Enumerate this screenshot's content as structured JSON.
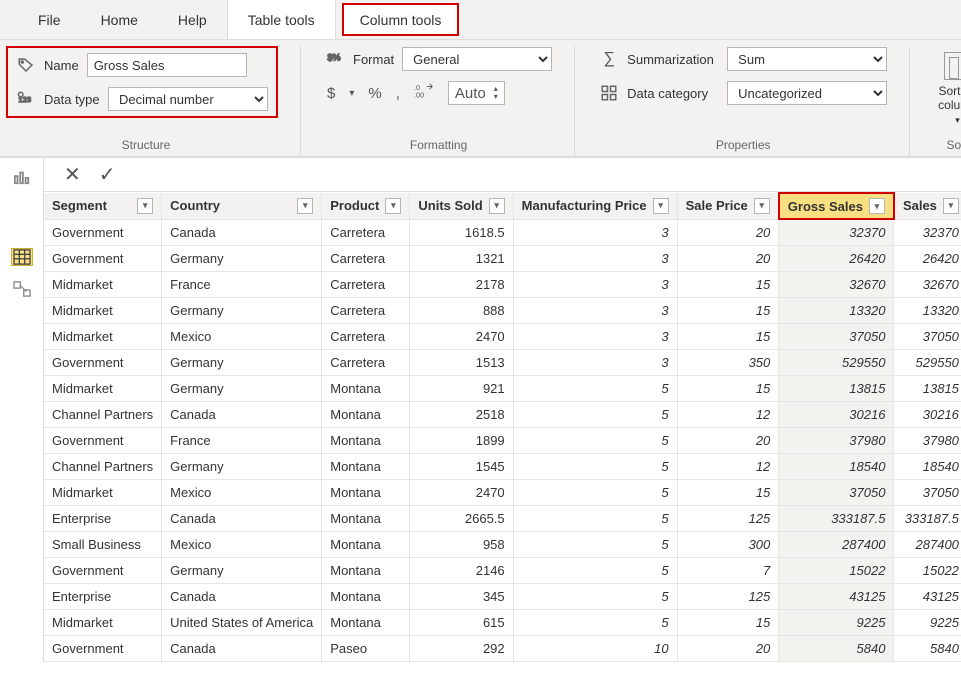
{
  "tabs": {
    "file": "File",
    "home": "Home",
    "help": "Help",
    "table_tools": "Table tools",
    "column_tools": "Column tools"
  },
  "ribbon": {
    "structure": {
      "group_label": "Structure",
      "name_label": "Name",
      "name_value": "Gross Sales",
      "datatype_label": "Data type",
      "datatype_value": "Decimal number"
    },
    "formatting": {
      "group_label": "Formatting",
      "format_label": "Format",
      "format_value": "General",
      "auto_label": "Auto",
      "currency": "$",
      "percent": "%",
      "comma": ",",
      "decimals": ".00"
    },
    "properties": {
      "group_label": "Properties",
      "summarization_label": "Summarization",
      "summarization_value": "Sum",
      "datacategory_label": "Data category",
      "datacategory_value": "Uncategorized"
    },
    "sort": {
      "group_label": "Sort",
      "button_line1": "Sort by",
      "button_line2": "column"
    }
  },
  "columns": [
    "Segment",
    "Country",
    "Product",
    "Units Sold",
    "Manufacturing Price",
    "Sale Price",
    "Gross Sales",
    "Sales"
  ],
  "selected_column": "Gross Sales",
  "rows": [
    {
      "segment": "Government",
      "country": "Canada",
      "product": "Carretera",
      "units": "1618.5",
      "mfg": "3",
      "price": "20",
      "gross": "32370",
      "sales": "32370"
    },
    {
      "segment": "Government",
      "country": "Germany",
      "product": "Carretera",
      "units": "1321",
      "mfg": "3",
      "price": "20",
      "gross": "26420",
      "sales": "26420"
    },
    {
      "segment": "Midmarket",
      "country": "France",
      "product": "Carretera",
      "units": "2178",
      "mfg": "3",
      "price": "15",
      "gross": "32670",
      "sales": "32670"
    },
    {
      "segment": "Midmarket",
      "country": "Germany",
      "product": "Carretera",
      "units": "888",
      "mfg": "3",
      "price": "15",
      "gross": "13320",
      "sales": "13320"
    },
    {
      "segment": "Midmarket",
      "country": "Mexico",
      "product": "Carretera",
      "units": "2470",
      "mfg": "3",
      "price": "15",
      "gross": "37050",
      "sales": "37050"
    },
    {
      "segment": "Government",
      "country": "Germany",
      "product": "Carretera",
      "units": "1513",
      "mfg": "3",
      "price": "350",
      "gross": "529550",
      "sales": "529550"
    },
    {
      "segment": "Midmarket",
      "country": "Germany",
      "product": "Montana",
      "units": "921",
      "mfg": "5",
      "price": "15",
      "gross": "13815",
      "sales": "13815"
    },
    {
      "segment": "Channel Partners",
      "country": "Canada",
      "product": "Montana",
      "units": "2518",
      "mfg": "5",
      "price": "12",
      "gross": "30216",
      "sales": "30216"
    },
    {
      "segment": "Government",
      "country": "France",
      "product": "Montana",
      "units": "1899",
      "mfg": "5",
      "price": "20",
      "gross": "37980",
      "sales": "37980"
    },
    {
      "segment": "Channel Partners",
      "country": "Germany",
      "product": "Montana",
      "units": "1545",
      "mfg": "5",
      "price": "12",
      "gross": "18540",
      "sales": "18540"
    },
    {
      "segment": "Midmarket",
      "country": "Mexico",
      "product": "Montana",
      "units": "2470",
      "mfg": "5",
      "price": "15",
      "gross": "37050",
      "sales": "37050"
    },
    {
      "segment": "Enterprise",
      "country": "Canada",
      "product": "Montana",
      "units": "2665.5",
      "mfg": "5",
      "price": "125",
      "gross": "333187.5",
      "sales": "333187.5"
    },
    {
      "segment": "Small Business",
      "country": "Mexico",
      "product": "Montana",
      "units": "958",
      "mfg": "5",
      "price": "300",
      "gross": "287400",
      "sales": "287400"
    },
    {
      "segment": "Government",
      "country": "Germany",
      "product": "Montana",
      "units": "2146",
      "mfg": "5",
      "price": "7",
      "gross": "15022",
      "sales": "15022"
    },
    {
      "segment": "Enterprise",
      "country": "Canada",
      "product": "Montana",
      "units": "345",
      "mfg": "5",
      "price": "125",
      "gross": "43125",
      "sales": "43125"
    },
    {
      "segment": "Midmarket",
      "country": "United States of America",
      "product": "Montana",
      "units": "615",
      "mfg": "5",
      "price": "15",
      "gross": "9225",
      "sales": "9225"
    },
    {
      "segment": "Government",
      "country": "Canada",
      "product": "Paseo",
      "units": "292",
      "mfg": "10",
      "price": "20",
      "gross": "5840",
      "sales": "5840"
    }
  ]
}
